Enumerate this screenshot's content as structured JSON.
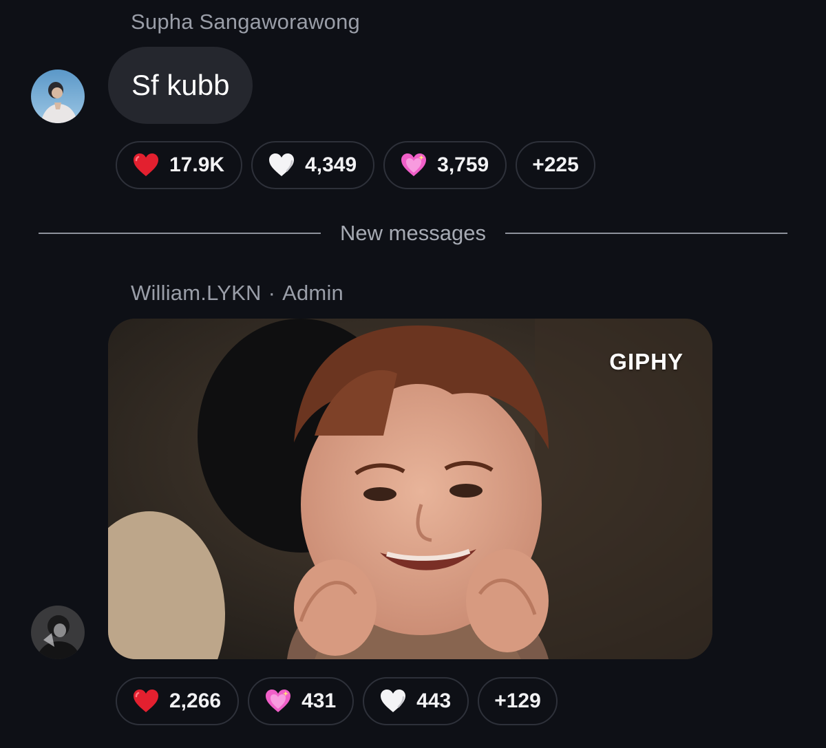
{
  "messages": [
    {
      "sender": "Supha Sangaworawong",
      "text": "Sf kubb",
      "reactions": [
        {
          "icon": "red-heart-icon",
          "count": "17.9K"
        },
        {
          "icon": "white-heart-icon",
          "count": "4,349"
        },
        {
          "icon": "sparkling-heart-icon",
          "count": "3,759"
        }
      ],
      "more_reactions": "+225"
    },
    {
      "sender": "William.LYKN",
      "separator": "·",
      "role": "Admin",
      "gif": {
        "watermark": "GIPHY"
      },
      "reactions": [
        {
          "icon": "red-heart-icon",
          "count": "2,266"
        },
        {
          "icon": "sparkling-heart-icon",
          "count": "431"
        },
        {
          "icon": "white-heart-icon",
          "count": "443"
        }
      ],
      "more_reactions": "+129"
    }
  ],
  "divider": {
    "label": "New messages"
  },
  "colors": {
    "background": "#0e1016",
    "bubble": "#25272e",
    "pill_border": "#2e313a",
    "muted_text": "#9a9ea8",
    "red_heart": "#e3202f",
    "white_heart": "#f4f4f6",
    "pink_heart": "#f05fc8"
  }
}
